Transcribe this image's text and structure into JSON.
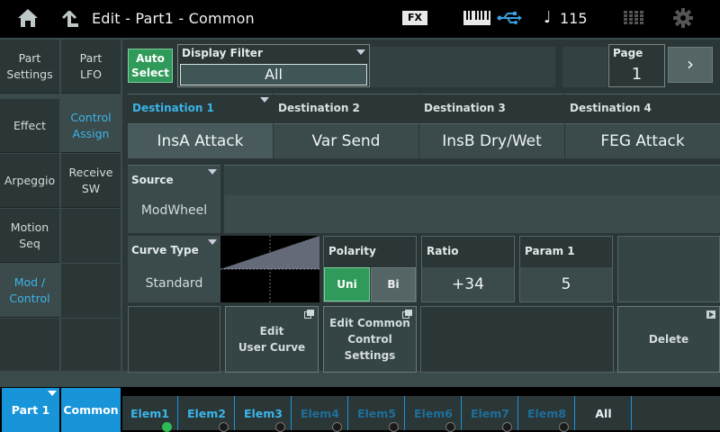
{
  "header": {
    "title": "Edit - Part1 - Common",
    "fx_label": "FX",
    "tempo": "115"
  },
  "nav_primary": [
    {
      "label": "Part\nSettings"
    },
    {
      "label": "Effect"
    },
    {
      "label": "Arpeggio"
    },
    {
      "label": "Motion\nSeq"
    },
    {
      "label": "Mod /\nControl",
      "active": true
    }
  ],
  "nav_secondary": [
    {
      "label": "Part\nLFO"
    },
    {
      "label": "Control\nAssign",
      "active": true
    },
    {
      "label": "Receive\nSW"
    }
  ],
  "controls": {
    "auto_select": "Auto\nSelect",
    "display_filter_label": "Display Filter",
    "display_filter_value": "All",
    "page_label": "Page",
    "page_value": "1",
    "next_glyph": "›"
  },
  "destinations": [
    {
      "label": "Destination 1",
      "value": "InsA Attack",
      "active": true
    },
    {
      "label": "Destination 2",
      "value": "Var Send"
    },
    {
      "label": "Destination 3",
      "value": "InsB Dry/Wet"
    },
    {
      "label": "Destination 4",
      "value": "FEG Attack"
    }
  ],
  "source": {
    "label": "Source",
    "value": "ModWheel"
  },
  "curve": {
    "label": "Curve Type",
    "value": "Standard"
  },
  "polarity": {
    "label": "Polarity",
    "uni": "Uni",
    "bi": "Bi",
    "selected": "Uni"
  },
  "ratio": {
    "label": "Ratio",
    "value": "+34"
  },
  "param1": {
    "label": "Param 1",
    "value": "5"
  },
  "actions": {
    "edit_user_curve": "Edit\nUser Curve",
    "edit_common_control": "Edit Common\nControl\nSettings",
    "delete": "Delete"
  },
  "bottom": {
    "part": "Part 1",
    "common": "Common",
    "elements": [
      {
        "label": "Elem1",
        "on": true,
        "lit": true
      },
      {
        "label": "Elem2",
        "on": true,
        "lit": false
      },
      {
        "label": "Elem3",
        "on": true,
        "lit": false
      },
      {
        "label": "Elem4",
        "on": false,
        "lit": false
      },
      {
        "label": "Elem5",
        "on": false,
        "lit": false
      },
      {
        "label": "Elem6",
        "on": false,
        "lit": false
      },
      {
        "label": "Elem7",
        "on": false,
        "lit": false
      },
      {
        "label": "Elem8",
        "on": false,
        "lit": false
      }
    ],
    "all": "All"
  },
  "colors": {
    "accent_blue": "#3ab5e8",
    "tab_blue": "#1894d8",
    "active_green": "#2f9a5a",
    "panel": "#2b3637"
  },
  "icons": [
    "home-icon",
    "up-arrow-icon",
    "fx-icon",
    "keyboard-icon",
    "usb-icon",
    "note-icon",
    "grid-icon",
    "gear-icon"
  ]
}
